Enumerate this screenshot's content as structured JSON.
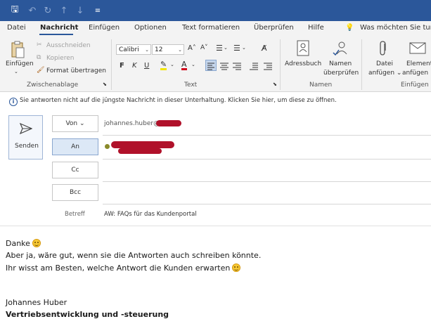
{
  "quick_access": {
    "save": "🖫",
    "undo": "↶",
    "redo": "↻",
    "up": "↑",
    "down": "↓",
    "more": "≡"
  },
  "tabs": [
    "Datei",
    "Nachricht",
    "Einfügen",
    "Optionen",
    "Text formatieren",
    "Überprüfen",
    "Hilfe"
  ],
  "tell_me": "Was möchten Sie tun?",
  "ribbon": {
    "clipboard": {
      "paste": "Einfügen",
      "cut": "Ausschneiden",
      "copy": "Kopieren",
      "format_painter": "Format übertragen",
      "label": "Zwischenablage"
    },
    "text": {
      "font": "Calibri",
      "size": "12",
      "bold": "F",
      "italic": "K",
      "underline": "U",
      "label": "Text"
    },
    "names": {
      "address_book": "Adressbuch",
      "check_names_1": "Namen",
      "check_names_2": "überprüfen",
      "label": "Namen"
    },
    "include": {
      "attach_file_1": "Datei",
      "attach_file_2": "anfügen",
      "attach_item_1": "Element",
      "attach_item_2": "anfügen",
      "label": "Einfügen"
    }
  },
  "info_bar": "Sie antworten nicht auf die jüngste Nachricht in dieser Unterhaltung. Klicken Sie hier, um diese zu öffnen.",
  "compose": {
    "send": "Senden",
    "from_label": "Von",
    "from_value": "johannes.huber@",
    "to_label": "An",
    "cc_label": "Cc",
    "bcc_label": "Bcc",
    "subject_label": "Betreff",
    "subject_value": "AW: FAQs für das Kundenportal"
  },
  "body": {
    "line1": "Danke",
    "line2": "Aber ja, wäre gut, wenn sie die Antworten auch schreiben könnte.",
    "line3": "Ihr wisst am Besten, welche Antwort die Kunden erwarten",
    "sig_name": "Johannes Huber",
    "sig_title": "Vertriebsentwicklung und -steuerung"
  },
  "colors": {
    "title_bar": "#2b579a",
    "ribbon": "#f3f3f3",
    "redaction": "#b0112a"
  }
}
